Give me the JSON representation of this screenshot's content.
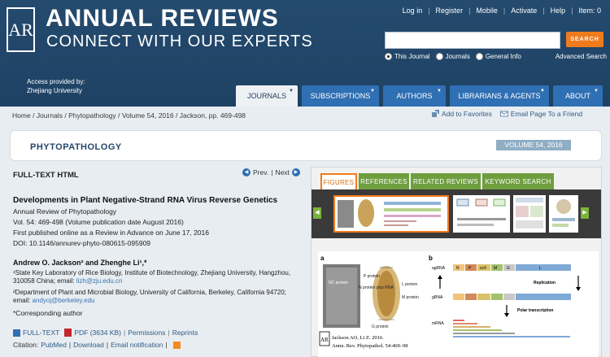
{
  "brand": {
    "logo_text": "AR",
    "line1": "ANNUAL REVIEWS",
    "line2": "CONNECT WITH OUR EXPERTS"
  },
  "access": {
    "label": "Access provided by:",
    "org": "Zhejiang University"
  },
  "utility": {
    "login": "Log in",
    "register": "Register",
    "mobile": "Mobile",
    "activate": "Activate",
    "help": "Help",
    "items": "Item: 0"
  },
  "search": {
    "placeholder": "",
    "button": "SEARCH",
    "options": [
      "This Journal",
      "Journals",
      "General Info"
    ],
    "advanced": "Advanced Search"
  },
  "nav": {
    "tabs": [
      "JOURNALS",
      "SUBSCRIPTIONS",
      "AUTHORS",
      "LIBRARIANS & AGENTS",
      "ABOUT"
    ],
    "arrow": "▼"
  },
  "breadcrumb": {
    "home": "Home",
    "journals": "Journals",
    "journal": "Phytopathology",
    "volume": "Volume 54, 2016",
    "pages": "Jackson, pp. 469-498",
    "sep": "/"
  },
  "actions": {
    "favorites": "Add to Favorites",
    "email": "Email Page To a Friend"
  },
  "journal": {
    "title": "PHYTOPATHOLOGY",
    "volume": "VOLUME 54, 2016"
  },
  "article": {
    "section": "FULL-TEXT HTML",
    "prev": "Prev.",
    "next": "Next",
    "nav_sep": "|",
    "title": "Developments in Plant Negative-Strand RNA Virus Reverse Genetics",
    "journal": "Annual Review of Phytopathology",
    "vol": "Vol. 54: 469-498 (Volume publication date August 2016)",
    "first_pub": "First published online as a Review in Advance on June 17, 2016",
    "doi": "DOI: 10.1146/annurev-phyto-080615-095909",
    "authors": "Andrew O. Jackson² and Zhenghe Li¹,*",
    "aff1": "¹State Key Laboratory of Rice Biology, Institute of Biotechnology, Zhejiang University, Hangzhou, 310058 China; email:",
    "aff1_email": "lizh@zju.edu.cn",
    "aff2": "²Department of Plant and Microbial Biology, University of California, Berkeley, California 94720; email:",
    "aff2_email": "andyoj@berkeley.edu",
    "corresponding": "*Corresponding author"
  },
  "tools": {
    "fulltext": "FULL-TEXT",
    "pdf": "PDF (3634 KB)",
    "permissions": "Permissions",
    "reprints": "Reprints",
    "sep": "|"
  },
  "citation": {
    "label": "Citation:",
    "pubmed": "PubMed",
    "download": "Download",
    "notification": "Email notification",
    "sep": "|"
  },
  "figures": {
    "tabs": [
      "FIGURES",
      "REFERENCES",
      "RELATED REVIEWS",
      "KEYWORD SEARCH"
    ],
    "left_arrow": "◀",
    "right_arrow": "▶",
    "panel_a": "a",
    "panel_b": "b",
    "labels_a": [
      "NC protein",
      "P protein",
      "N protein plus RNA",
      "L protein",
      "M protein",
      "G protein"
    ],
    "labels_b": [
      "agRNA",
      "gRNA",
      "mRNA",
      "Replication",
      "Polar transcription"
    ],
    "genes": [
      "N",
      "P",
      "sc4",
      "M",
      "G",
      "L"
    ],
    "credit_logo": "AR",
    "credit_line1": "Jackson AO, Li Z. 2016.",
    "credit_line2": "Annu. Rev. Phytopathol. 54:469–98"
  },
  "colors": {
    "header_bg": "#1f4466",
    "nav_tab": "#2f6fb3",
    "search_btn": "#f07b1d",
    "figure_tab": "#6f9e3f"
  }
}
